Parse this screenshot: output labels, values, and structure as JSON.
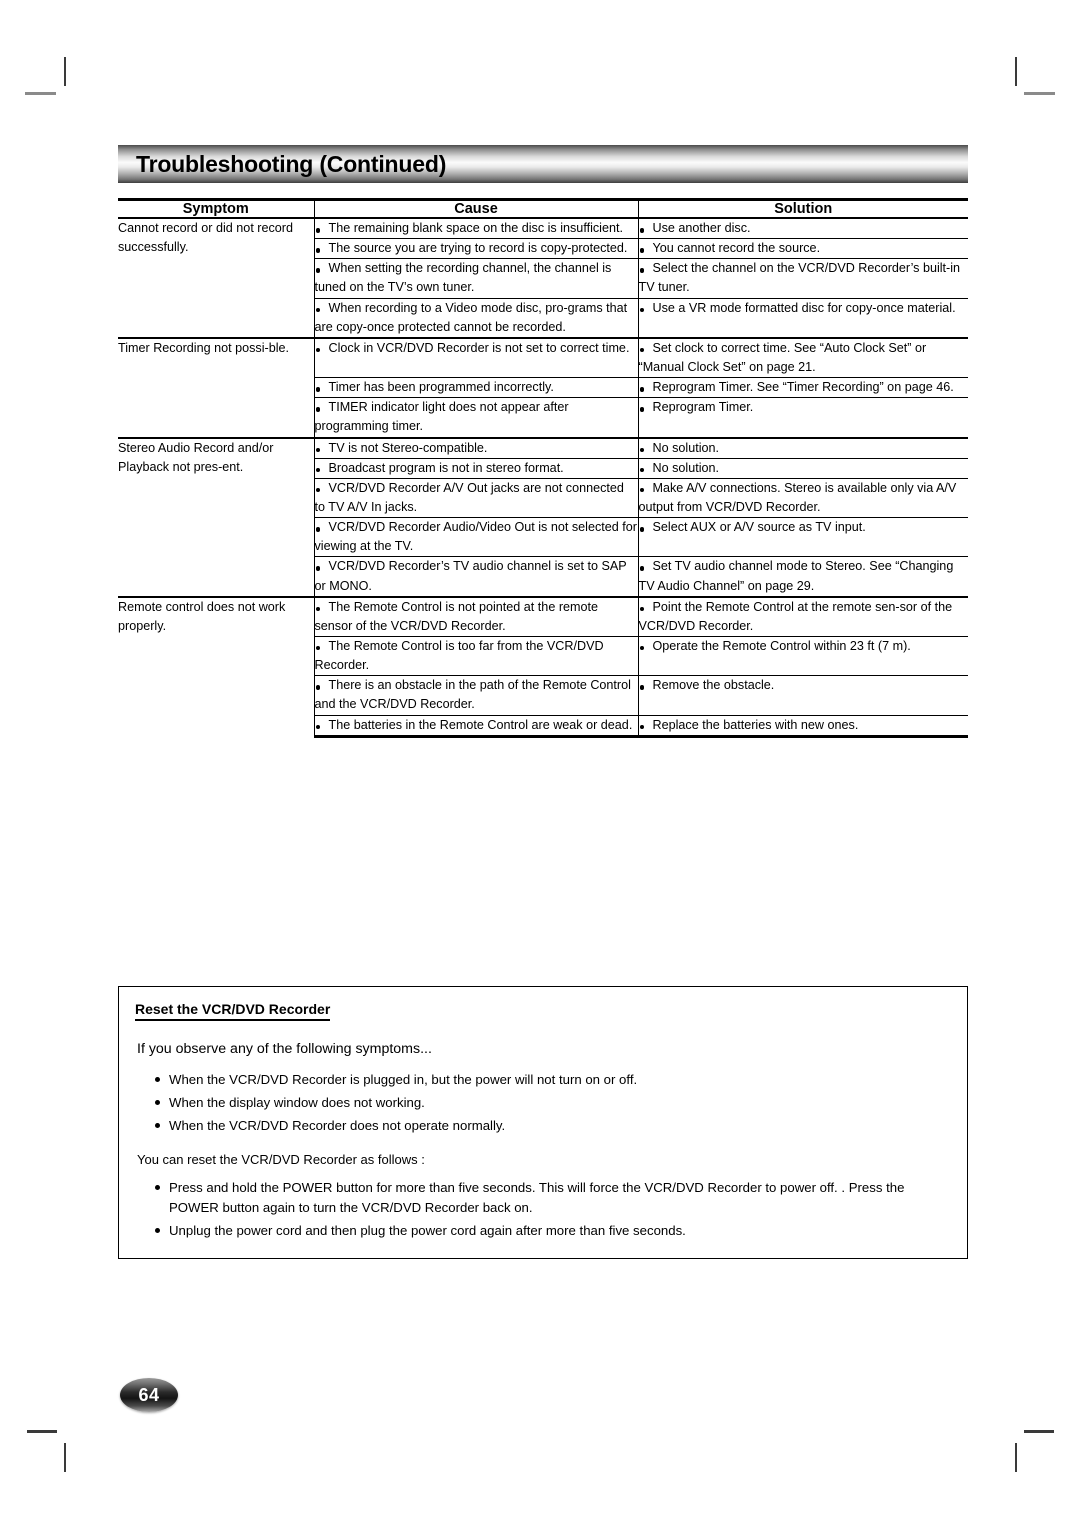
{
  "page": {
    "title": "Troubleshooting (Continued)",
    "page_number": "64"
  },
  "table": {
    "headers": {
      "symptom": "Symptom",
      "cause": "Cause",
      "solution": "Solution"
    },
    "groups": [
      {
        "symptom": "Cannot record or did not record successfully.",
        "rows": [
          {
            "cause": "The remaining blank space on the disc is insufficient.",
            "solution": "Use another disc."
          },
          {
            "cause": "The source you are trying to record is copy-protected.",
            "solution": "You cannot record the source."
          },
          {
            "cause": "When setting the recording channel, the channel is tuned on the TV’s own tuner.",
            "solution": "Select the channel on the VCR/DVD Recorder’s built-in TV tuner."
          },
          {
            "cause": "When recording to a Video mode disc, pro-grams that are copy-once protected cannot be recorded.",
            "solution": "Use a VR mode formatted disc for copy-once material."
          }
        ]
      },
      {
        "symptom": "Timer Recording not possi-ble.",
        "rows": [
          {
            "cause": "Clock in VCR/DVD Recorder is not set to correct time.",
            "solution": "Set clock to correct time. See “Auto Clock Set” or “Manual Clock Set” on page 21."
          },
          {
            "cause": "Timer has been programmed incorrectly.",
            "solution": "Reprogram Timer. See “Timer Recording” on page 46."
          },
          {
            "cause": "TIMER indicator light does not appear after programming timer.",
            "solution": "Reprogram Timer."
          }
        ]
      },
      {
        "symptom": "Stereo Audio Record and/or Playback not pres-ent.",
        "rows": [
          {
            "cause": "TV is not Stereo-compatible.",
            "solution": "No solution."
          },
          {
            "cause": "Broadcast program is not in stereo format.",
            "solution": "No solution."
          },
          {
            "cause": "VCR/DVD Recorder A/V Out jacks are not connected to TV A/V In jacks.",
            "solution": "Make A/V connections. Stereo is available only via A/V output from VCR/DVD Recorder."
          },
          {
            "cause": "VCR/DVD Recorder Audio/Video Out is not selected for viewing at the TV.",
            "solution": "Select AUX or A/V source as TV input."
          },
          {
            "cause": "VCR/DVD Recorder’s TV audio channel is set to SAP or MONO.",
            "solution": "Set TV audio channel mode to Stereo. See “Changing TV Audio Channel” on page 29."
          }
        ]
      },
      {
        "symptom": "Remote control does not work properly.",
        "rows": [
          {
            "cause": "The Remote Control is not pointed at the remote sensor of the VCR/DVD Recorder.",
            "solution": "Point the Remote Control at the remote sen-sor of the VCR/DVD Recorder."
          },
          {
            "cause": "The Remote Control is too far from the VCR/DVD Recorder.",
            "solution": "Operate the Remote Control within 23 ft (7 m)."
          },
          {
            "cause": "There is an obstacle in the path of the Remote Control and the VCR/DVD Recorder.",
            "solution": "Remove the obstacle."
          },
          {
            "cause": "The batteries in the Remote Control are weak or dead.",
            "solution": "Replace the batteries with new ones."
          }
        ]
      }
    ]
  },
  "reset_box": {
    "heading": "Reset the VCR/DVD Recorder",
    "intro": "If you observe any of the following symptoms...",
    "symptoms": [
      "When the VCR/DVD Recorder is plugged in, but the power will not turn on or off.",
      "When the display window does not working.",
      "When the VCR/DVD Recorder does not operate normally."
    ],
    "note": "You can reset the VCR/DVD Recorder as follows :",
    "steps": [
      "Press and hold  the POWER button for more than five seconds. This will force the VCR/DVD Recorder to power off. . Press the POWER button again to turn the VCR/DVD Recorder back on.",
      "Unplug the power cord and then plug the power cord again after more than five seconds."
    ]
  }
}
